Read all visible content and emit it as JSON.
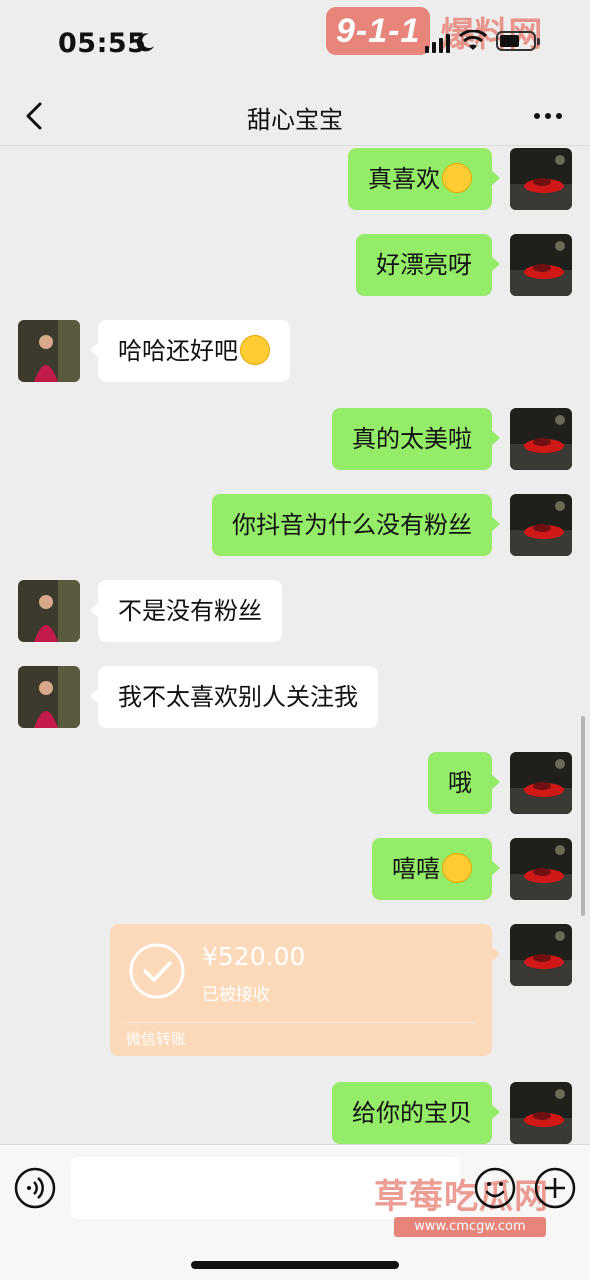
{
  "status_bar": {
    "time": "05:55",
    "watermark_badge": "9-1-1",
    "watermark_text": "爆料网"
  },
  "nav": {
    "title": "甜心宝宝",
    "back_icon": "chevron-left-icon",
    "more_icon": "more-dots-icon"
  },
  "messages": [
    {
      "from": "self",
      "text": "真喜欢",
      "emoji": "heart-eyes"
    },
    {
      "from": "self",
      "text": "好漂亮呀"
    },
    {
      "from": "other",
      "text": "哈哈还好吧",
      "emoji": "thinking"
    },
    {
      "from": "self",
      "text": "真的太美啦"
    },
    {
      "from": "self",
      "text": "你抖音为什么没有粉丝"
    },
    {
      "from": "other",
      "text": "不是没有粉丝"
    },
    {
      "from": "other",
      "text": "我不太喜欢别人关注我"
    },
    {
      "from": "self",
      "text": "哦"
    },
    {
      "from": "self",
      "text": "嘻嘻",
      "emoji": "grin"
    },
    {
      "from": "self",
      "type": "transfer",
      "amount": "¥520.00",
      "status": "已被接收",
      "label": "微信转账"
    },
    {
      "from": "self",
      "text": "给你的宝贝"
    }
  ],
  "input_bar": {
    "voice_icon": "voice-icon",
    "emoji_icon": "emoji-icon",
    "plus_icon": "plus-icon",
    "watermark": "草莓吃瓜网",
    "watermark_url": "www.cmcgw.com"
  },
  "colors": {
    "self_bubble": "#95ec69",
    "other_bubble": "#ffffff",
    "transfer_card": "#fcd9b8",
    "background": "#ededed"
  }
}
